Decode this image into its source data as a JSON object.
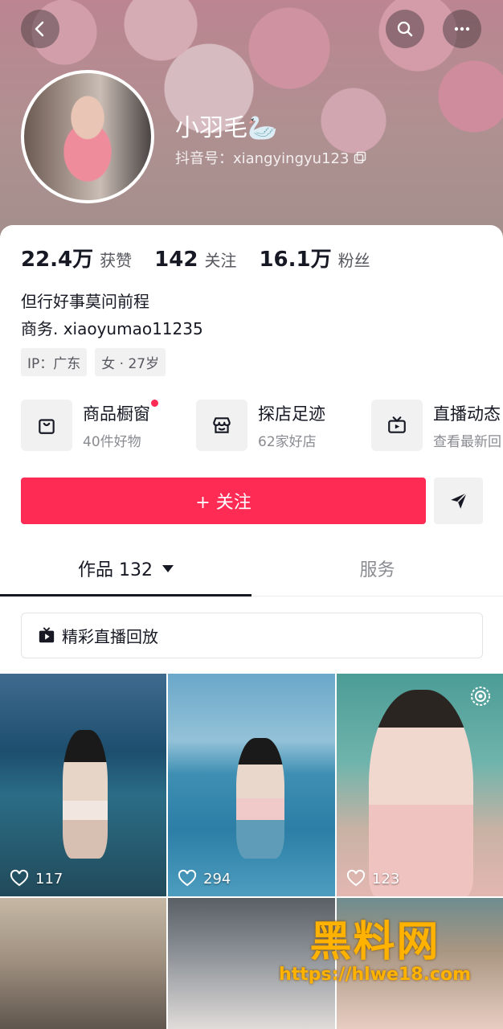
{
  "header": {
    "nickname": "小羽毛🦢",
    "douyin_id": "抖音号：xiangyingyu123"
  },
  "stats": [
    {
      "num": "22.4万",
      "label": "获赞"
    },
    {
      "num": "142",
      "label": "关注"
    },
    {
      "num": "16.1万",
      "label": "粉丝"
    }
  ],
  "bio": {
    "line1": "但行好事莫问前程",
    "line2": "商务. xiaoyumao11235"
  },
  "tags": [
    "IP：广东",
    "女 · 27岁"
  ],
  "features": [
    {
      "title": "商品橱窗",
      "sub": "40件好物",
      "icon": "shopping-bag-icon"
    },
    {
      "title": "探店足迹",
      "sub": "62家好店",
      "icon": "store-icon"
    },
    {
      "title": "直播动态",
      "sub": "查看最新回",
      "icon": "tv-icon"
    }
  ],
  "actions": {
    "follow_label": "+ 关注"
  },
  "tabs": {
    "works_label": "作品 132",
    "service_label": "服务"
  },
  "replay_label": "精彩直播回放",
  "videos": [
    {
      "likes": "117"
    },
    {
      "likes": "294"
    },
    {
      "likes": "123"
    }
  ],
  "watermark": {
    "title": "黑料网",
    "url": "https://hlwe18.com"
  },
  "colors": {
    "accent": "#fe2c55",
    "watermark": "#ffb300"
  }
}
